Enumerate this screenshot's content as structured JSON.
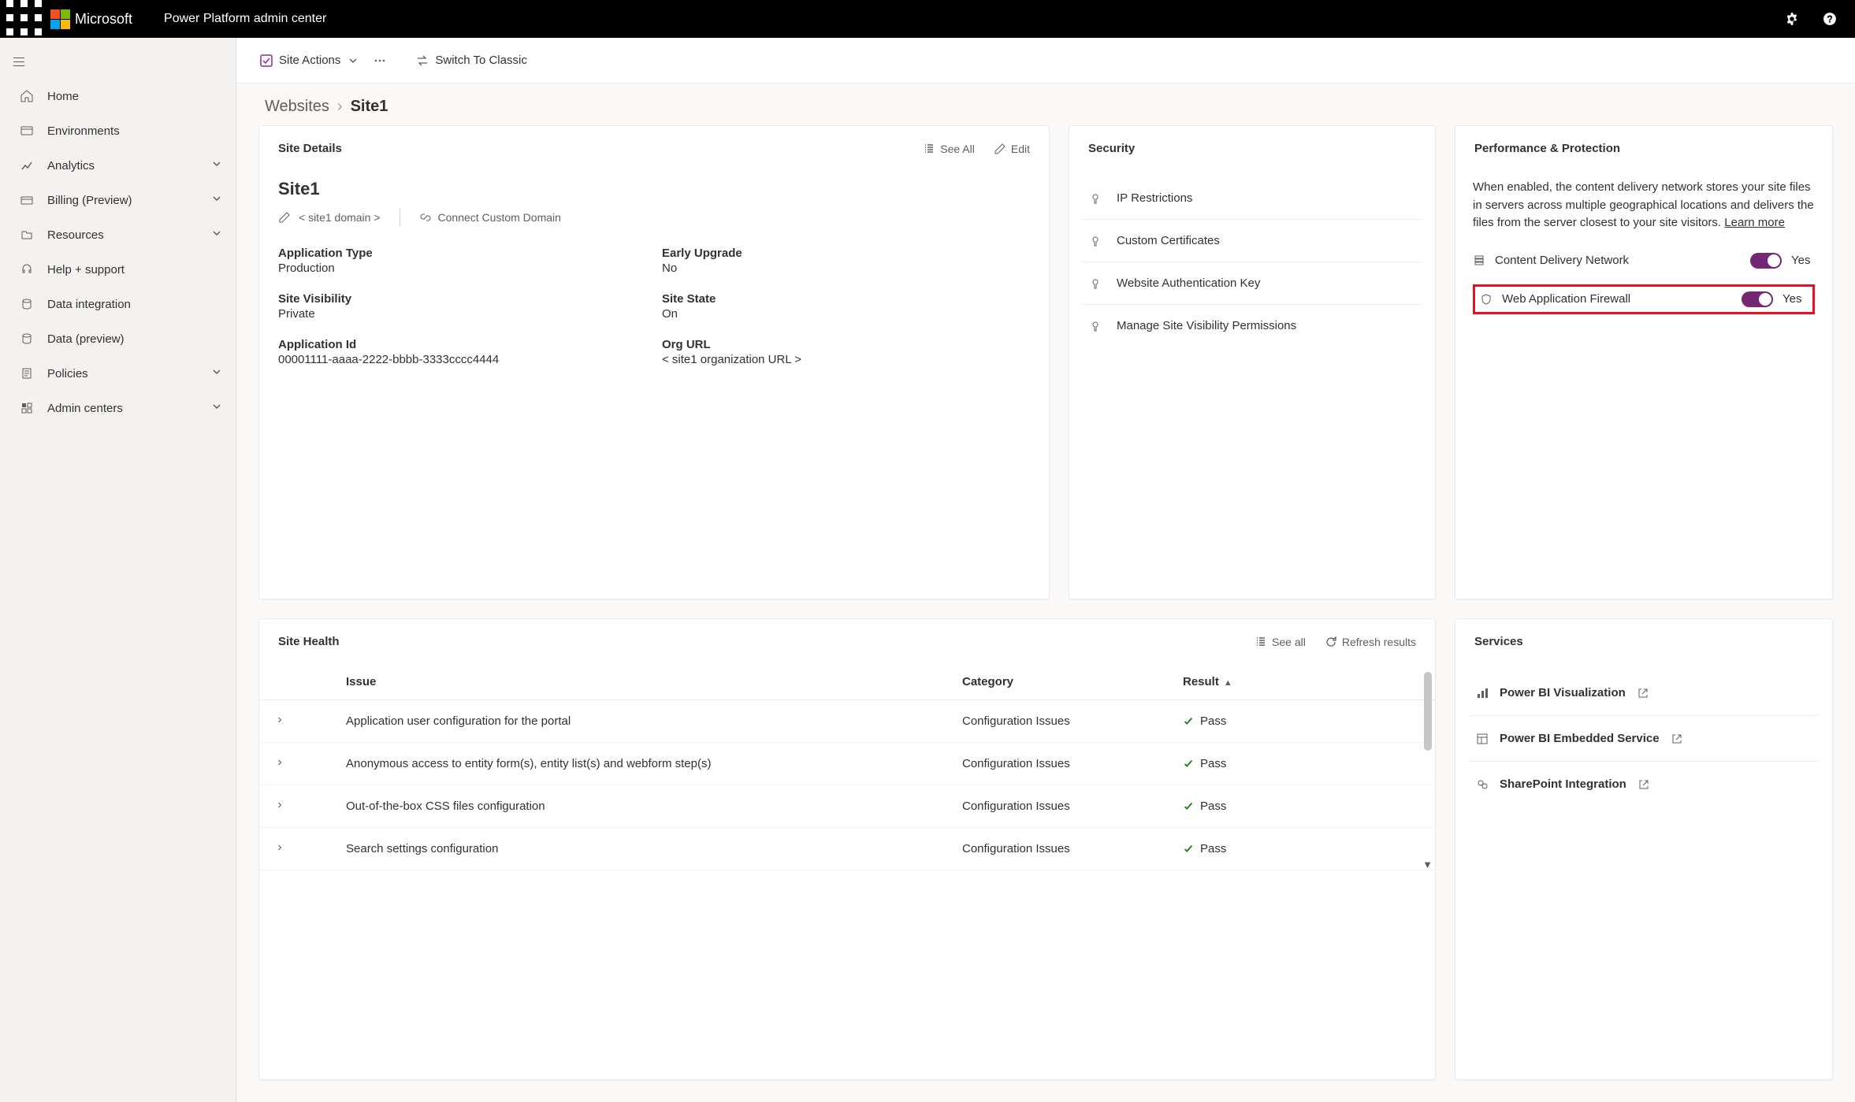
{
  "header": {
    "brand": "Microsoft",
    "app_title": "Power Platform admin center"
  },
  "sidebar": {
    "items": [
      {
        "label": "Home",
        "expandable": false
      },
      {
        "label": "Environments",
        "expandable": false
      },
      {
        "label": "Analytics",
        "expandable": true
      },
      {
        "label": "Billing (Preview)",
        "expandable": true
      },
      {
        "label": "Resources",
        "expandable": true
      },
      {
        "label": "Help + support",
        "expandable": false
      },
      {
        "label": "Data integration",
        "expandable": false
      },
      {
        "label": "Data (preview)",
        "expandable": false
      },
      {
        "label": "Policies",
        "expandable": true
      },
      {
        "label": "Admin centers",
        "expandable": true
      }
    ]
  },
  "toolbar": {
    "site_actions": "Site Actions",
    "switch_classic": "Switch To Classic"
  },
  "breadcrumb": {
    "parent": "Websites",
    "current": "Site1"
  },
  "site_details": {
    "panel_title": "Site Details",
    "see_all": "See All",
    "edit": "Edit",
    "title": "Site1",
    "domain": "< site1 domain >",
    "connect_custom_domain": "Connect Custom Domain",
    "fields": {
      "app_type_label": "Application Type",
      "app_type_value": "Production",
      "early_upgrade_label": "Early Upgrade",
      "early_upgrade_value": "No",
      "visibility_label": "Site Visibility",
      "visibility_value": "Private",
      "state_label": "Site State",
      "state_value": "On",
      "app_id_label": "Application Id",
      "app_id_value": "00001111-aaaa-2222-bbbb-3333cccc4444",
      "org_url_label": "Org URL",
      "org_url_value": "< site1 organization URL >"
    }
  },
  "security": {
    "panel_title": "Security",
    "items": [
      "IP Restrictions",
      "Custom Certificates",
      "Website Authentication Key",
      "Manage Site Visibility Permissions"
    ]
  },
  "performance": {
    "panel_title": "Performance & Protection",
    "description": "When enabled, the content delivery network stores your site files in servers across multiple geographical locations and delivers the files from the server closest to your site visitors. ",
    "learn_more": "Learn more",
    "cdn_label": "Content Delivery Network",
    "cdn_state": "Yes",
    "waf_label": "Web Application Firewall",
    "waf_state": "Yes"
  },
  "site_health": {
    "panel_title": "Site Health",
    "see_all": "See all",
    "refresh": "Refresh results",
    "columns": {
      "issue": "Issue",
      "category": "Category",
      "result": "Result"
    },
    "rows": [
      {
        "issue": "Application user configuration for the portal",
        "category": "Configuration Issues",
        "result": "Pass"
      },
      {
        "issue": "Anonymous access to entity form(s), entity list(s) and webform step(s)",
        "category": "Configuration Issues",
        "result": "Pass"
      },
      {
        "issue": "Out-of-the-box CSS files configuration",
        "category": "Configuration Issues",
        "result": "Pass"
      },
      {
        "issue": "Search settings configuration",
        "category": "Configuration Issues",
        "result": "Pass"
      }
    ]
  },
  "services": {
    "panel_title": "Services",
    "items": [
      "Power BI Visualization",
      "Power BI Embedded Service",
      "SharePoint Integration"
    ]
  }
}
